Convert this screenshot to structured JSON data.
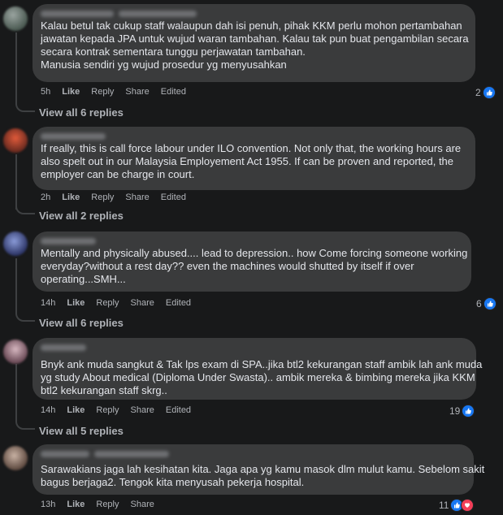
{
  "colors": {
    "background": "#18191a",
    "bubble": "#3a3b3c",
    "text": "#e4e6eb",
    "secondary_text": "#b0b3b8",
    "like_blue": "#1877f2",
    "love_red": "#f33e58"
  },
  "comments": [
    {
      "lines": [
        "Kalau betul tak cukup staff walaupun dah isi penuh, pihak KKM perlu mohon pertambahan",
        "jawatan kepada JPA untuk wujud waran tambahan. Kalau tak pun buat pengambilan secara",
        "secara kontrak sementara tunggu perjawatan tambahan.",
        "Manusia sendiri yg wujud prosedur yg menyusahkan"
      ],
      "time": "5h",
      "like": "Like",
      "reply": "Reply",
      "share": "Share",
      "edited": "Edited",
      "reaction_count": "2",
      "reactions": [
        "like-icon"
      ],
      "view_replies": "View all 6 replies"
    },
    {
      "lines": [
        "If really, this is call force labour under ILO convention. Not only that, the working hours are",
        "also spelt out in our Malaysia Employement Act 1955. If can be proven and reported, the",
        "employer can be charge in court."
      ],
      "time": "2h",
      "like": "Like",
      "reply": "Reply",
      "share": "Share",
      "edited": "Edited",
      "reaction_count": "",
      "reactions": [],
      "view_replies": "View all 2 replies"
    },
    {
      "lines": [
        "Mentally and physically abused.... lead to depression.. how Come forcing someone working",
        "everyday?without a rest day?? even the machines would shutted by itself if over",
        "operating...SMH..."
      ],
      "time": "14h",
      "like": "Like",
      "reply": "Reply",
      "share": "Share",
      "edited": "Edited",
      "reaction_count": "6",
      "reactions": [
        "like-icon"
      ],
      "view_replies": "View all 6 replies"
    },
    {
      "lines": [
        "Bnyk ank muda sangkut & Tak lps exam di SPA..jika btl2 kekurangan staff ambik lah ank muda",
        "yg study About medical (Diploma Under Swasta).. ambik mereka & bimbing mereka jika KKM",
        "btl2 kekurangan staff skrg.."
      ],
      "time": "14h",
      "like": "Like",
      "reply": "Reply",
      "share": "Share",
      "edited": "Edited",
      "reaction_count": "19",
      "reactions": [
        "like-icon"
      ],
      "view_replies": "View all 5 replies"
    },
    {
      "lines": [
        "Sarawakians jaga lah kesihatan kita. Jaga apa yg kamu masok dlm mulut kamu. Sebelom sakit",
        "bagus berjaga2. Tengok kita menyusah pekerja hospital."
      ],
      "time": "13h",
      "like": "Like",
      "reply": "Reply",
      "share": "Share",
      "edited": "",
      "reaction_count": "11",
      "reactions": [
        "like-icon",
        "love-icon"
      ],
      "view_replies": ""
    }
  ]
}
